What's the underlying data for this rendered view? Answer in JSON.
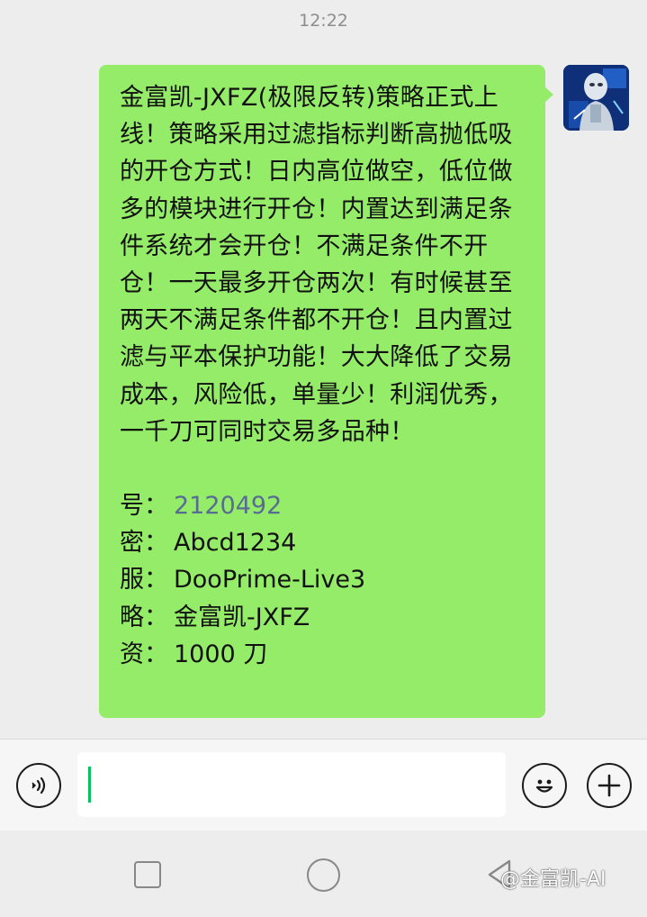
{
  "status": {
    "time": "12:22"
  },
  "message": {
    "body": "金富凯-JXFZ(极限反转)策略正式上线！策略采用过滤指标判断高抛低吸的开仓方式！日内高位做空，低位做多的模块进行开仓！内置达到满足条件系统才会开仓！不满足条件不开仓！一天最多开仓两次！有时候甚至两天不满足条件都不开仓！且内置过滤与平本保护功能！大大降低了交易成本，风险低，单量少！利润优秀，一千刀可同时交易多品种！",
    "info": [
      {
        "label": "号：",
        "value": "2120492",
        "is_link": true
      },
      {
        "label": "密：",
        "value": "Abcd1234",
        "is_link": false
      },
      {
        "label": "服：",
        "value": "DooPrime-Live3",
        "is_link": false
      },
      {
        "label": "略：",
        "value": "金富凯-JXFZ",
        "is_link": false
      },
      {
        "label": "资：",
        "value": "1000 刀",
        "is_link": false
      }
    ]
  },
  "input": {
    "value": ""
  },
  "watermark": "@金富凯-AI",
  "icons": {
    "voice": "voice-icon",
    "emoji": "emoji-icon",
    "plus": "plus-icon",
    "nav_recent": "recent-apps-icon",
    "nav_home": "home-icon",
    "nav_back": "back-icon"
  },
  "colors": {
    "bubble": "#95ec69",
    "link": "#576b95",
    "background": "#ededed",
    "caret": "#07c160"
  }
}
